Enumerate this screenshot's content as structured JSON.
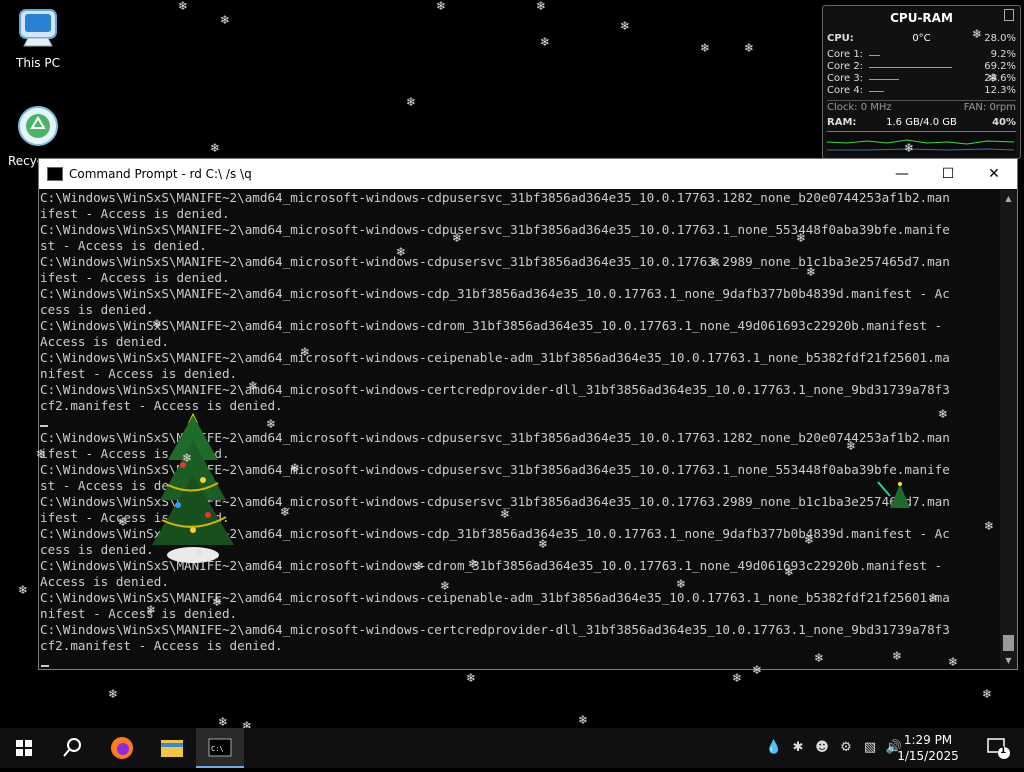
{
  "desktop": {
    "icons": [
      {
        "label": "This PC"
      },
      {
        "label": "Recyc"
      }
    ]
  },
  "gadget": {
    "title": "CPU-RAM",
    "cpu_label": "CPU:",
    "temp": "0°C",
    "cpu_percent": "28.0%",
    "cores": [
      {
        "label": "Core 1:",
        "value": "9.2%",
        "level": 0.092
      },
      {
        "label": "Core 2:",
        "value": "69.2%",
        "level": 0.692
      },
      {
        "label": "Core 3:",
        "value": "24.6%",
        "level": 0.246
      },
      {
        "label": "Core 4:",
        "value": "12.3%",
        "level": 0.123
      }
    ],
    "clock": "Clock: 0 MHz",
    "fan": "FAN: 0rpm",
    "ram_label": "RAM:",
    "ram_usage": "1.6 GB/4.0 GB",
    "ram_percent": "40%"
  },
  "cmd": {
    "title": "Command Prompt - rd  C:\\ /s \\q",
    "lines": [
      "C:\\Windows\\WinSxS\\MANIFE~2\\amd64_microsoft-windows-cdpusersvc_31bf3856ad364e35_10.0.17763.1282_none_b20e0744253af1b2.man",
      "ifest - Access is denied.",
      "C:\\Windows\\WinSxS\\MANIFE~2\\amd64_microsoft-windows-cdpusersvc_31bf3856ad364e35_10.0.17763.1_none_553448f0aba39bfe.manife",
      "st - Access is denied.",
      "C:\\Windows\\WinSxS\\MANIFE~2\\amd64_microsoft-windows-cdpusersvc_31bf3856ad364e35_10.0.17763.2989_none_b1c1ba3e257465d7.man",
      "ifest - Access is denied.",
      "C:\\Windows\\WinSxS\\MANIFE~2\\amd64_microsoft-windows-cdp_31bf3856ad364e35_10.0.17763.1_none_9dafb377b0b4839d.manifest - Ac",
      "cess is denied.",
      "C:\\Windows\\WinSxS\\MANIFE~2\\amd64_microsoft-windows-cdrom_31bf3856ad364e35_10.0.17763.1_none_49d061693c22920b.manifest -",
      "Access is denied.",
      "C:\\Windows\\WinSxS\\MANIFE~2\\amd64_microsoft-windows-ceipenable-adm_31bf3856ad364e35_10.0.17763.1_none_b5382fdf21f25601.ma",
      "nifest - Access is denied.",
      "C:\\Windows\\WinSxS\\MANIFE~2\\amd64_microsoft-windows-certcredprovider-dll_31bf3856ad364e35_10.0.17763.1_none_9bd31739a78f3",
      "cf2.manifest - Access is denied.",
      "",
      "C:\\Windows\\WinSxS\\MANIFE~2\\amd64_microsoft-windows-cdpusersvc_31bf3856ad364e35_10.0.17763.1282_none_b20e0744253af1b2.man",
      "ifest - Access is denied.",
      "C:\\Windows\\WinSxS\\MANIFE~2\\amd64_microsoft-windows-cdpusersvc_31bf3856ad364e35_10.0.17763.1_none_553448f0aba39bfe.manife",
      "st - Access is denied.",
      "C:\\Windows\\WinSxS\\MANIFE~2\\amd64_microsoft-windows-cdpusersvc_31bf3856ad364e35_10.0.17763.2989_none_b1c1ba3e257465d7.man",
      "ifest - Access is denied.",
      "C:\\Windows\\WinSxS\\MANIFE~2\\amd64_microsoft-windows-cdp_31bf3856ad364e35_10.0.17763.1_none_9dafb377b0b4839d.manifest - Ac",
      "cess is denied.",
      "C:\\Windows\\WinSxS\\MANIFE~2\\amd64_microsoft-windows-cdrom_31bf3856ad364e35_10.0.17763.1_none_49d061693c22920b.manifest -",
      "Access is denied.",
      "C:\\Windows\\WinSxS\\MANIFE~2\\amd64_microsoft-windows-ceipenable-adm_31bf3856ad364e35_10.0.17763.1_none_b5382fdf21f25601.ma",
      "nifest - Access is denied.",
      "C:\\Windows\\WinSxS\\MANIFE~2\\amd64_microsoft-windows-certcredprovider-dll_31bf3856ad364e35_10.0.17763.1_none_9bd31739a78f3",
      "cf2.manifest - Access is denied."
    ]
  },
  "taskbar": {
    "time": "1:29 PM",
    "date": "1/15/2025",
    "notification_count": "1",
    "icons": [
      "windows-start-icon",
      "search-icon",
      "firefox-icon",
      "file-explorer-icon",
      "command-prompt-icon"
    ],
    "tray_icons": [
      "water-drop-icon",
      "snowflake-icon",
      "user-icon",
      "key-icon",
      "network-icon",
      "volume-icon"
    ]
  }
}
